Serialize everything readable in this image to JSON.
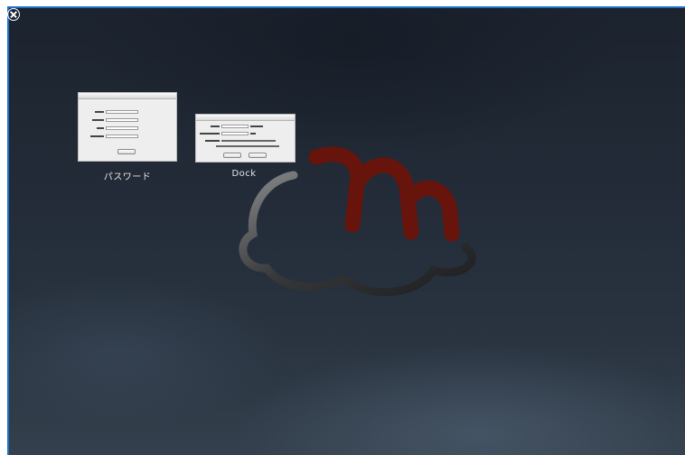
{
  "window": {
    "close_icon": "close-circle-icon",
    "accent": "#1a73c8"
  },
  "thumbnails": [
    {
      "label": "パスワード",
      "icon": "password-window-thumbnail"
    },
    {
      "label": "Dock",
      "icon": "dock-window-thumbnail"
    }
  ],
  "logo": {
    "icon": "cloud-m-logo",
    "color": "#7a1408"
  }
}
